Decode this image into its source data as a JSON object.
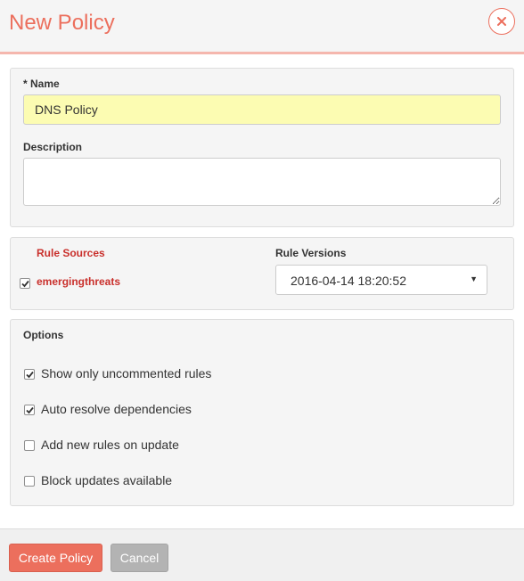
{
  "dialog": {
    "title": "New Policy",
    "close_icon": "close-icon",
    "accent_color": "#ec6f5d"
  },
  "general": {
    "name_label": "* Name",
    "name_value": "DNS Policy",
    "description_label": "Description",
    "description_value": ""
  },
  "rules": {
    "sources_header": "Rule Sources",
    "versions_header": "Rule Versions",
    "sources": [
      {
        "name": "emergingthreats",
        "checked": true,
        "version": "2016-04-14 18:20:52"
      }
    ]
  },
  "options": {
    "header": "Options",
    "items": [
      {
        "label": "Show only uncommented rules",
        "checked": true
      },
      {
        "label": "Auto resolve dependencies",
        "checked": true
      },
      {
        "label": "Add new rules on update",
        "checked": false
      },
      {
        "label": "Block updates available",
        "checked": false
      }
    ]
  },
  "footer": {
    "create_label": "Create Policy",
    "cancel_label": "Cancel"
  }
}
